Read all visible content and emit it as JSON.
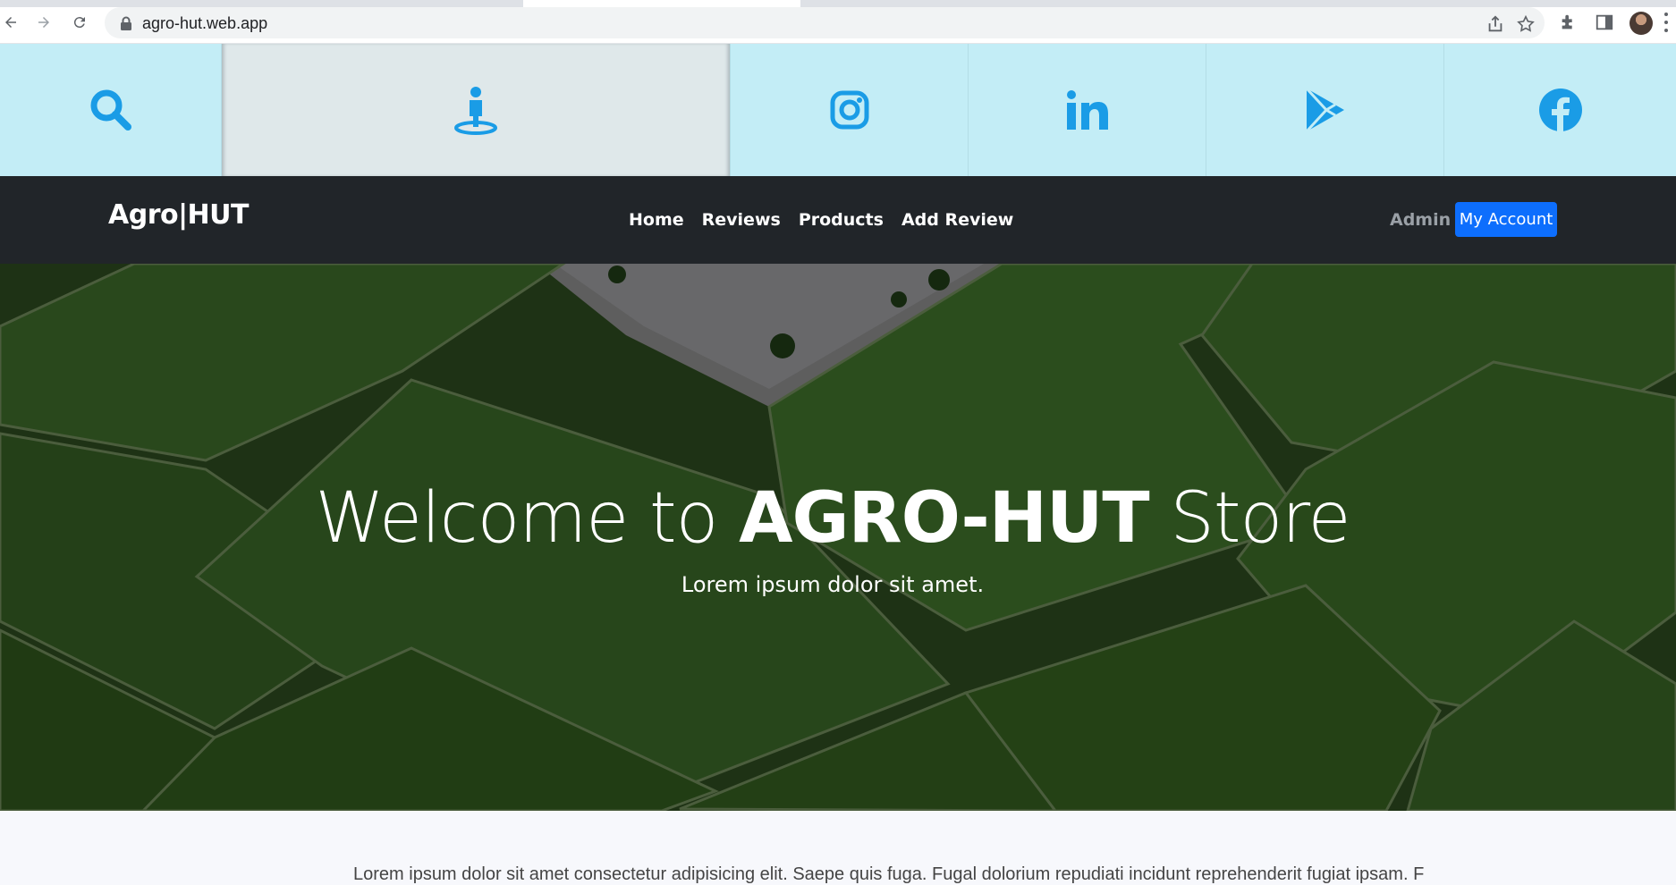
{
  "browser": {
    "url": "agro-hut.web.app"
  },
  "social_bar": {
    "items": [
      {
        "icon": "search-icon"
      },
      {
        "icon": "location-person-icon"
      },
      {
        "icon": "instagram-icon"
      },
      {
        "icon": "linkedin-icon"
      },
      {
        "icon": "google-play-icon"
      },
      {
        "icon": "facebook-icon"
      }
    ],
    "icon_color": "#1a9ce6",
    "background": "#c3edf6"
  },
  "navbar": {
    "brand": "Agro|HUT",
    "links": [
      "Home",
      "Reviews",
      "Products",
      "Add Review"
    ],
    "admin": "Admin",
    "account_button": "My Account",
    "account_button_color": "#0d6efd"
  },
  "hero": {
    "title_prefix": "Welcome to ",
    "title_bold": "AGRO-HUT",
    "title_suffix": " Store",
    "subtitle": "Lorem ipsum dolor sit amet."
  },
  "below": {
    "text": "Lorem ipsum dolor sit amet consectetur adipisicing elit. Saepe quis fuga. Fugal dolorium repudiati incidunt reprehenderit fugiat ipsam. F"
  }
}
